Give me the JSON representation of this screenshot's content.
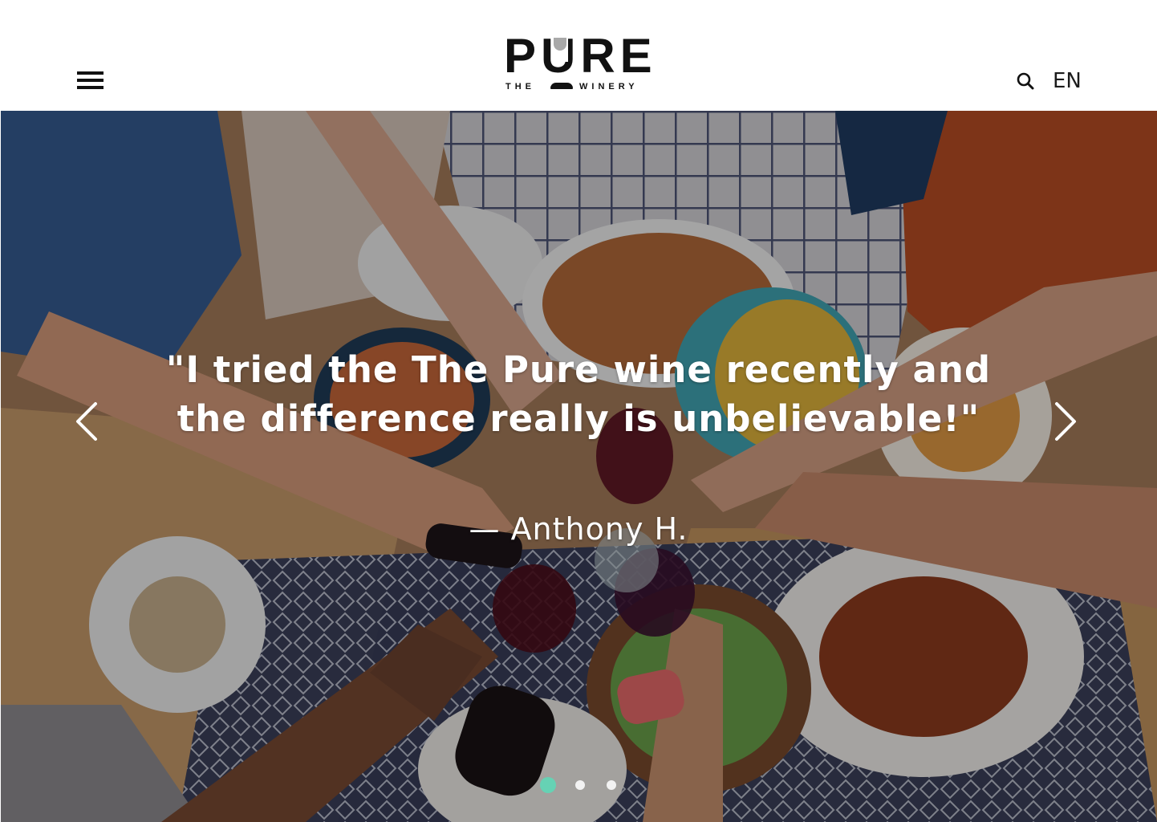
{
  "header": {
    "logo": {
      "word": "PURE",
      "left_text": "THE",
      "right_text": "WINERY"
    },
    "menu_icon": "hamburger-menu-icon",
    "search_icon": "search-icon",
    "language": "EN"
  },
  "hero": {
    "background": "photo of friends toasting with red wine over a picnic table",
    "quote": "\"I tried the The Pure wine recently and the difference really is unbelievable!\"",
    "author": "— Anthony H.",
    "prev_icon": "chevron-left-icon",
    "next_icon": "chevron-right-icon",
    "slides": 3,
    "active_slide": 1
  },
  "colors": {
    "accent": "#66d2b4",
    "text_dark": "#111111",
    "header_bg": "#ffffff"
  }
}
